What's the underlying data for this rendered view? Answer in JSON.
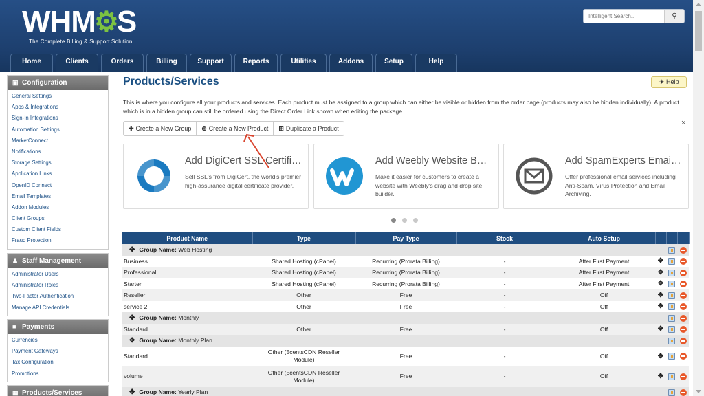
{
  "header": {
    "logo_text": "WHMCS",
    "logo_before_gear": "WHM",
    "logo_gear": "⚙",
    "logo_after_gear": "S",
    "tagline": "The Complete Billing & Support Solution"
  },
  "search": {
    "placeholder": "Intelligent Search...",
    "icon": "search-icon"
  },
  "nav": {
    "tabs": [
      "Home",
      "Clients",
      "Orders",
      "Billing",
      "Support",
      "Reports",
      "Utilities",
      "Addons",
      "Setup",
      "Help"
    ]
  },
  "sidebar": {
    "configuration": {
      "title": "Configuration",
      "icon": "document-icon",
      "items": [
        "General Settings",
        "Apps & Integrations",
        "Sign-In Integrations",
        "Automation Settings",
        "MarketConnect",
        "Notifications",
        "Storage Settings",
        "Application Links",
        "OpenID Connect",
        "Email Templates",
        "Addon Modules",
        "Client Groups",
        "Custom Client Fields",
        "Fraud Protection"
      ]
    },
    "staff": {
      "title": "Staff Management",
      "icon": "users-icon",
      "items": [
        "Administrator Users",
        "Administrator Roles",
        "Two-Factor Authentication",
        "Manage API Credentials"
      ]
    },
    "payments": {
      "title": "Payments",
      "icon": "money-icon",
      "items": [
        "Currencies",
        "Payment Gateways",
        "Tax Configuration",
        "Promotions"
      ]
    },
    "products": {
      "title": "Products/Services",
      "icon": "box-icon"
    }
  },
  "page": {
    "title": "Products/Services",
    "help_label": "Help",
    "intro": "This is where you configure all your products and services. Each product must be assigned to a group which can either be visible or hidden from the order page (products may also be hidden individually). A product which is in a hidden group can still be ordered using the Direct Order Link shown when editing the package.",
    "buttons": {
      "create_group": "Create a New Group",
      "create_product": "Create a New Product",
      "duplicate_product": "Duplicate a Product"
    },
    "dismiss": "×"
  },
  "promos": [
    {
      "title": "Add DigiCert SSL Certificates",
      "desc": "Sell SSL's from DigiCert, the world's premier high-assurance digital certificate provider.",
      "icon": "digicert-icon",
      "color": "#1a7ac0"
    },
    {
      "title": "Add Weebly Website Builder",
      "desc": "Make it easier for customers to create a website with Weebly's drag and drop site builder.",
      "icon": "weebly-icon",
      "color": "#2196d3"
    },
    {
      "title": "Add SpamExperts Email Security",
      "desc": "Offer professional email services including Anti-Spam, Virus Protection and Email Archiving.",
      "icon": "spamexperts-icon",
      "color": "#555555"
    }
  ],
  "carousel": {
    "count": 3,
    "active": 0
  },
  "table": {
    "headers": [
      "Product Name",
      "Type",
      "Pay Type",
      "Stock",
      "Auto Setup"
    ],
    "group_prefix": "Group Name:",
    "rows": [
      {
        "kind": "group",
        "name": "Web Hosting"
      },
      {
        "kind": "product",
        "name": "Business",
        "type": "Shared Hosting (cPanel)",
        "pay": "Recurring (Prorata Billing)",
        "stock": "-",
        "setup": "After First Payment"
      },
      {
        "kind": "product",
        "name": "Professional",
        "type": "Shared Hosting (cPanel)",
        "pay": "Recurring (Prorata Billing)",
        "stock": "-",
        "setup": "After First Payment"
      },
      {
        "kind": "product",
        "name": "Starter",
        "type": "Shared Hosting (cPanel)",
        "pay": "Recurring (Prorata Billing)",
        "stock": "-",
        "setup": "After First Payment"
      },
      {
        "kind": "product",
        "name": "Reseller",
        "type": "Other",
        "pay": "Free",
        "stock": "-",
        "setup": "Off"
      },
      {
        "kind": "product",
        "name": "service 2",
        "type": "Other",
        "pay": "Free",
        "stock": "-",
        "setup": "Off"
      },
      {
        "kind": "group",
        "name": "Monthly"
      },
      {
        "kind": "product",
        "name": "Standard",
        "type": "Other",
        "pay": "Free",
        "stock": "-",
        "setup": "Off"
      },
      {
        "kind": "group",
        "name": "Monthly Plan"
      },
      {
        "kind": "product",
        "name": "Standard",
        "type": "Other (5centsCDN Reseller Module)",
        "pay": "Free",
        "stock": "-",
        "setup": "Off",
        "tall": true
      },
      {
        "kind": "product",
        "name": "volume",
        "type": "Other (5centsCDN Reseller Module)",
        "pay": "Free",
        "stock": "-",
        "setup": "Off",
        "tall": true
      },
      {
        "kind": "group",
        "name": "Yearly Plan"
      }
    ]
  },
  "colors": {
    "header": "#1f4677",
    "nav_tab": "#1a3a63",
    "table_head": "#1f4d80",
    "link": "#1b4f85",
    "annotation_arrow": "#d9452f"
  }
}
